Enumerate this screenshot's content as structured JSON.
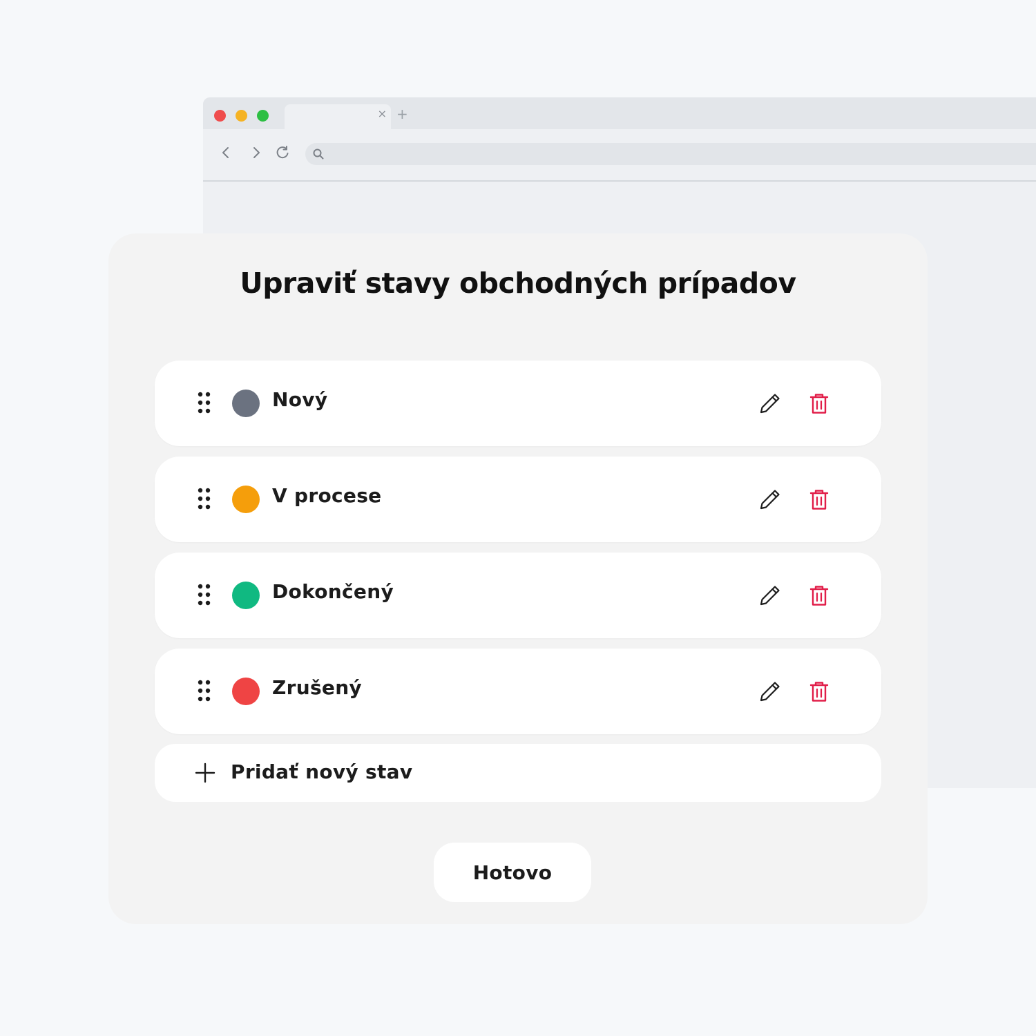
{
  "browser": {
    "controls": [
      "close",
      "minimize",
      "maximize"
    ],
    "control_colors": {
      "close": "#ef4d4d",
      "minimize": "#f5b324",
      "maximize": "#2dbf43"
    },
    "tab_close_label": "×",
    "new_tab_label": "+",
    "address_icon": "search-icon",
    "nav_icons": [
      "back-icon",
      "forward-icon",
      "reload-icon"
    ]
  },
  "dialog": {
    "title": "Upraviť stavy obchodných prípadov",
    "statuses": [
      {
        "label": "Nový",
        "color": "#6b7280"
      },
      {
        "label": "V procese",
        "color": "#f59e0b"
      },
      {
        "label": "Dokončený",
        "color": "#10b981"
      },
      {
        "label": "Zrušený",
        "color": "#ef4444"
      }
    ],
    "row_icons": {
      "drag": "drag-handle-icon",
      "edit": "pencil-icon",
      "delete": "trash-icon"
    },
    "delete_color": "#e11d48",
    "add_label": "Pridať nový stav",
    "done_label": "Hotovo"
  }
}
